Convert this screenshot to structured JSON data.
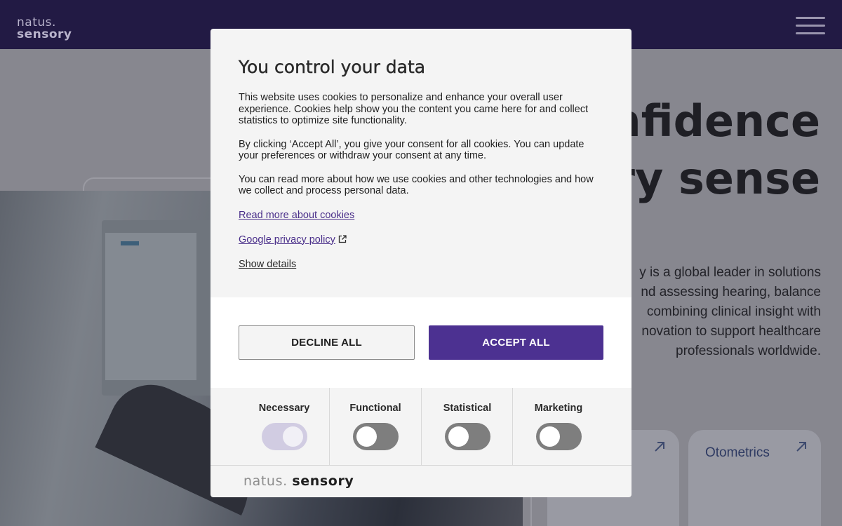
{
  "header": {
    "logo_line1": "natus.",
    "logo_line2": "sensory",
    "menu_icon": "hamburger-menu-icon"
  },
  "hero": {
    "title_line1": "nfidence",
    "title_line2": "ery sense",
    "text_line1": "y is a global leader in solutions",
    "text_line2": "nd assessing hearing, balance",
    "text_line3": "combining clinical insight with",
    "text_line4": "novation to support healthcare",
    "text_line5": "professionals worldwide.",
    "cards": [
      {
        "label": "",
        "icon": "arrow-up-right-icon"
      },
      {
        "label": "Otometrics",
        "icon": "arrow-up-right-icon"
      }
    ]
  },
  "cookie_modal": {
    "title": "You control your data",
    "paragraph1": "This website uses cookies to personalize and enhance your overall user experience. Cookies help show you the content you came here for and collect statistics to optimize site functionality.",
    "paragraph2": "By clicking ‘Accept All’, you give your consent for all cookies. You can update your preferences or withdraw your consent at any time.",
    "paragraph3": "You can read more about how we use cookies and other technologies and how we collect and process personal data.",
    "link_read_more": "Read more about cookies",
    "link_privacy": "Google privacy policy",
    "external_icon": "external-link-icon",
    "link_show_details": "Show details",
    "decline_label": "DECLINE ALL",
    "accept_label": "ACCEPT ALL",
    "toggles": [
      {
        "label": "Necessary",
        "on": true,
        "disabled": true
      },
      {
        "label": "Functional",
        "on": false
      },
      {
        "label": "Statistical",
        "on": false
      },
      {
        "label": "Marketing",
        "on": false
      }
    ],
    "footer_logo_word1": "natus.",
    "footer_logo_word2": "sensory"
  },
  "colors": {
    "header_bg": "#221a44",
    "accent": "#4c3191",
    "link": "#4a2f8a"
  }
}
